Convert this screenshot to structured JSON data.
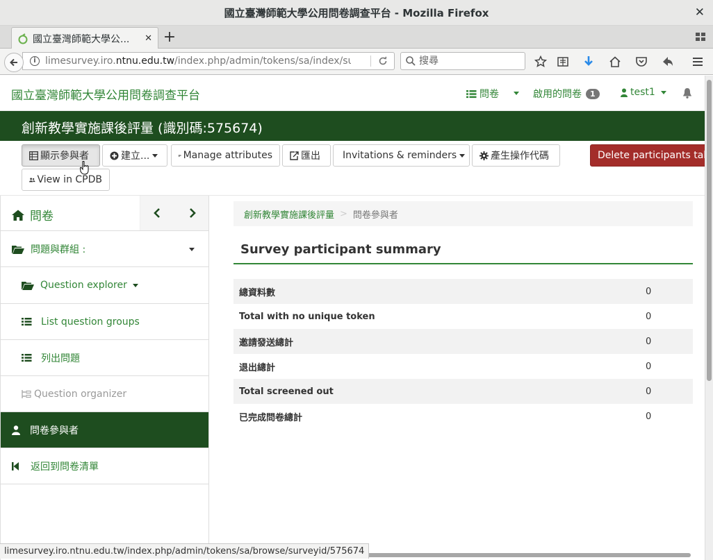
{
  "window": {
    "title": "國立臺灣師範大學公用問卷調查平台 - Mozilla Firefox"
  },
  "tab": {
    "label": "國立臺灣師範大學公..."
  },
  "urlbar": {
    "prefix": "limesurvey.iro.",
    "host": "ntnu.edu.tw",
    "path": "/index.php/admin/tokens/sa/index/surveyic"
  },
  "search": {
    "placeholder": "搜尋"
  },
  "topnav": {
    "brand": "國立臺灣師範大學公用問卷調查平台",
    "surveys": "問卷",
    "active_surveys": "啟用的問卷",
    "active_count": "1",
    "user": "test1"
  },
  "survey": {
    "title": "創新教學實施課後評量 (識別碼:575674)"
  },
  "toolbar": {
    "display_participants": "顯示參與者",
    "create": "建立...",
    "manage_attributes": "Manage attributes",
    "export": "匯出",
    "invitations": "Invitations & reminders",
    "generate_tokens": "產生操作代碼",
    "delete_table": "Delete participants table",
    "view_cpdb": "View in CPDB"
  },
  "sidebar": {
    "home": "問卷",
    "groups": "問題與群組 :",
    "question_explorer": "Question explorer",
    "list_groups": "List question groups",
    "list_questions": "列出問題",
    "organizer": "Question organizer",
    "participants": "問卷參與者",
    "back_to_list": "返回到問卷清單"
  },
  "breadcrumb": {
    "survey": "創新教學實施課後評量",
    "separator": ">",
    "current": "問卷參與者"
  },
  "summary": {
    "title": "Survey participant summary",
    "rows": [
      {
        "label": "總資料數",
        "value": "0"
      },
      {
        "label": "Total with no unique token",
        "value": "0"
      },
      {
        "label": "邀請發送總計",
        "value": "0"
      },
      {
        "label": "退出總計",
        "value": "0"
      },
      {
        "label": "Total screened out",
        "value": "0"
      },
      {
        "label": "已完成問卷總計",
        "value": "0"
      }
    ]
  },
  "statusbar": {
    "url": "limesurvey.iro.ntnu.edu.tw/index.php/admin/tokens/sa/browse/surveyid/575674"
  },
  "colors": {
    "brand_green": "#328637",
    "header_dark_green": "#1e4d1f",
    "danger": "#a32d2a"
  }
}
